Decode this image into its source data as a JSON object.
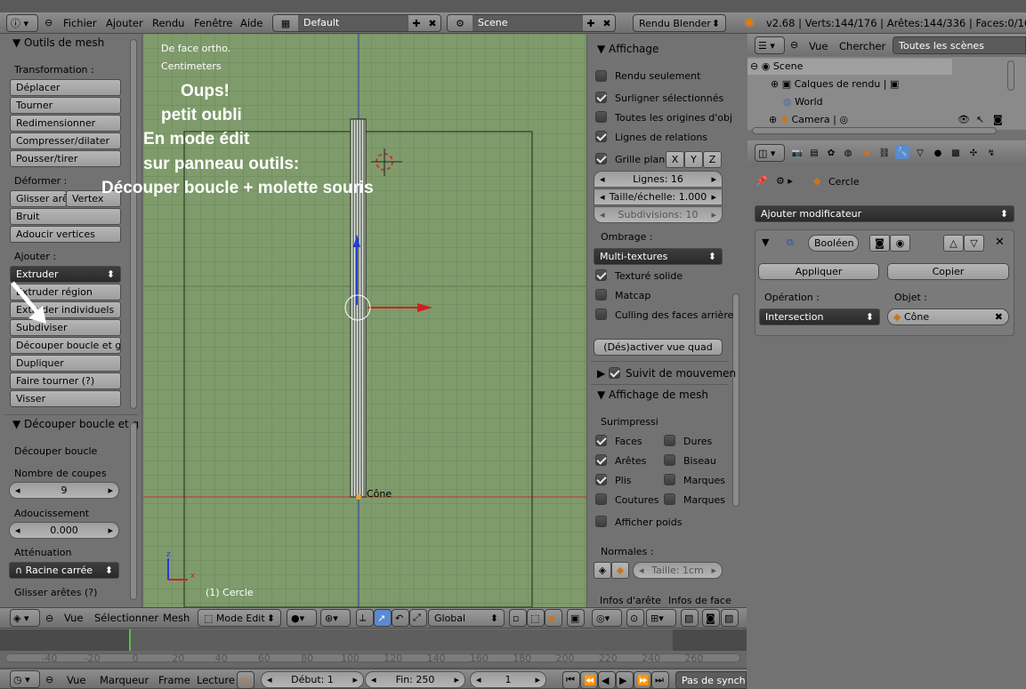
{
  "top_menu": {
    "items": [
      "Fichier",
      "Ajouter",
      "Rendu",
      "Fenêtre",
      "Aide"
    ],
    "layout": "Default",
    "scene": "Scene",
    "engine": "Rendu Blender",
    "stats": "v2.68 | Verts:144/176 | Arêtes:144/336 | Faces:0/161 |"
  },
  "tool_panel": {
    "title": "Outils de mesh",
    "transformation_label": "Transformation :",
    "transform_buttons": [
      "Déplacer",
      "Tourner",
      "Redimensionner",
      "Compresser/dilater",
      "Pousser/tirer"
    ],
    "deformer_label": "Déformer :",
    "slide_edge": "Glisser arê",
    "slide_vertex": "Vertex",
    "noise": "Bruit",
    "smooth_vertices": "Adoucir vertices",
    "add_label": "Ajouter :",
    "extrude": "Extruder",
    "add_buttons": [
      "Extruder région",
      "Extruder individuels",
      "Subdiviser",
      "Découper boucle et glis",
      "Dupliquer",
      "Faire tourner (?)",
      "Visser"
    ],
    "op_title": "Découper boucle et g",
    "op_name": "Découper boucle",
    "cuts_label": "Nombre de coupes",
    "cuts_value": "9",
    "smoothness_label": "Adoucissement",
    "smoothness_value": "0.000",
    "falloff_label": "Atténuation",
    "falloff_value": "Racine carrée",
    "edge_slide_label": "Glisser arêtes (?)"
  },
  "viewport": {
    "view_name": "De face ortho.",
    "units": "Centimeters",
    "object_label": "Cône",
    "status": "(1) Cercle",
    "annotation": [
      "Oups!",
      "petit oubli",
      "En mode édit",
      "sur panneau outils:",
      "Découper boucle + molette souris"
    ],
    "axis_z": "z",
    "axis_x": "x"
  },
  "properties_panel": {
    "display_title": "Affichage",
    "only_render": "Rendu seulement",
    "outline_selected": "Surligner sélectionnés",
    "all_origins": "Toutes les origines d'obj",
    "relationship_lines": "Lignes de relations",
    "grid_floor": "Grille plan",
    "axes": [
      "X",
      "Y",
      "Z"
    ],
    "lines": "Lignes: 16",
    "scale": "Taille/échelle: 1.000",
    "subdivisions": "Subdivisions: 10",
    "shading_label": "Ombrage :",
    "shading_value": "Multi-textures",
    "textured_solid": "Texturé solide",
    "matcap": "Matcap",
    "backface_culling": "Culling des faces arrière",
    "quad_view": "(Dés)activer vue quad",
    "motion_tracking": "Suivit de mouvemen",
    "mesh_display_title": "Affichage de mesh",
    "overlays_label": "Surimpressi",
    "faces": "Faces",
    "creases_hard": "Dures",
    "edges": "Arêtes",
    "bevel": "Biseau",
    "creases": "Plis",
    "marks1": "Marques",
    "seams": "Coutures",
    "marks2": "Marques",
    "weights": "Afficher poids",
    "normals_label": "Normales :",
    "normal_size": "Taille: 1cm",
    "edge_info": "Infos d'arête",
    "face_info": "Infos de face"
  },
  "outliner": {
    "view": "Vue",
    "search": "Chercher",
    "filter": "Toutes les scènes",
    "rows": [
      "Scene",
      "Calques de rendu",
      "World",
      "Camera"
    ]
  },
  "modifiers": {
    "object_name": "Cercle",
    "add_modifier": "Ajouter modificateur",
    "modifier_name": "Booléen",
    "apply": "Appliquer",
    "copy": "Copier",
    "operation_label": "Opération :",
    "object_label": "Objet :",
    "operation_value": "Intersection",
    "object_value": "Cône"
  },
  "view_header": {
    "items": [
      "Vue",
      "Sélectionner",
      "Mesh"
    ],
    "mode": "Mode Edit",
    "orientation": "Global"
  },
  "timeline": {
    "ticks": [
      "-40",
      "-20",
      "0",
      "20",
      "40",
      "60",
      "80",
      "100",
      "120",
      "140",
      "160",
      "180",
      "200",
      "220",
      "240",
      "260"
    ],
    "menu": [
      "Vue",
      "Marqueur",
      "Frame",
      "Lecture"
    ],
    "start": "Début: 1",
    "end": "Fin: 250",
    "current": "1",
    "sync": "Pas de synchro"
  },
  "colors": {
    "viewport_bg": "#7e9a6a",
    "grid": "#6a8458",
    "accent_blue": "#5a8ad0"
  }
}
